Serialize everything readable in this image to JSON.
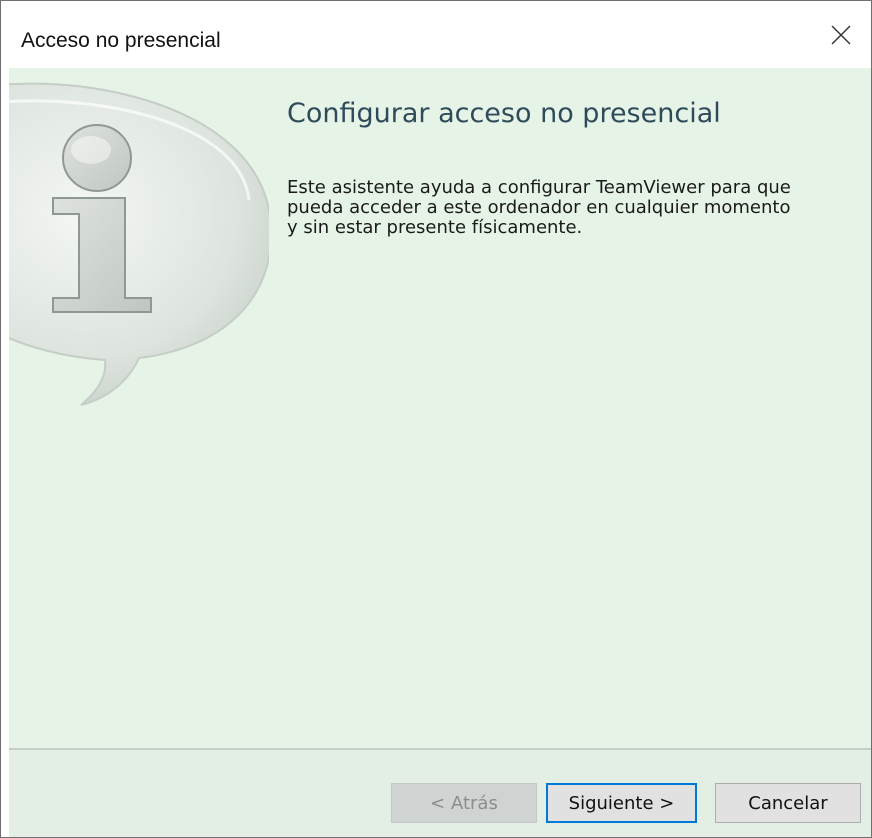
{
  "window": {
    "title": "Acceso no presencial",
    "close_icon": "close-icon"
  },
  "content": {
    "heading": "Configurar acceso no presencial",
    "description_lines": [
      "Este asistente ayuda a configurar TeamViewer para que",
      "pueda acceder a este ordenador en cualquier momento",
      "y sin estar presente físicamente."
    ],
    "icon": "info-speech-bubble-icon"
  },
  "footer": {
    "back_label": "< Atrás",
    "next_label": "Siguiente >",
    "cancel_label": "Cancelar"
  },
  "colors": {
    "content_bg": "#e6f4e8",
    "footer_bg": "#e3eee4",
    "heading": "#2f4b5a",
    "focus_border": "#0078d7"
  }
}
